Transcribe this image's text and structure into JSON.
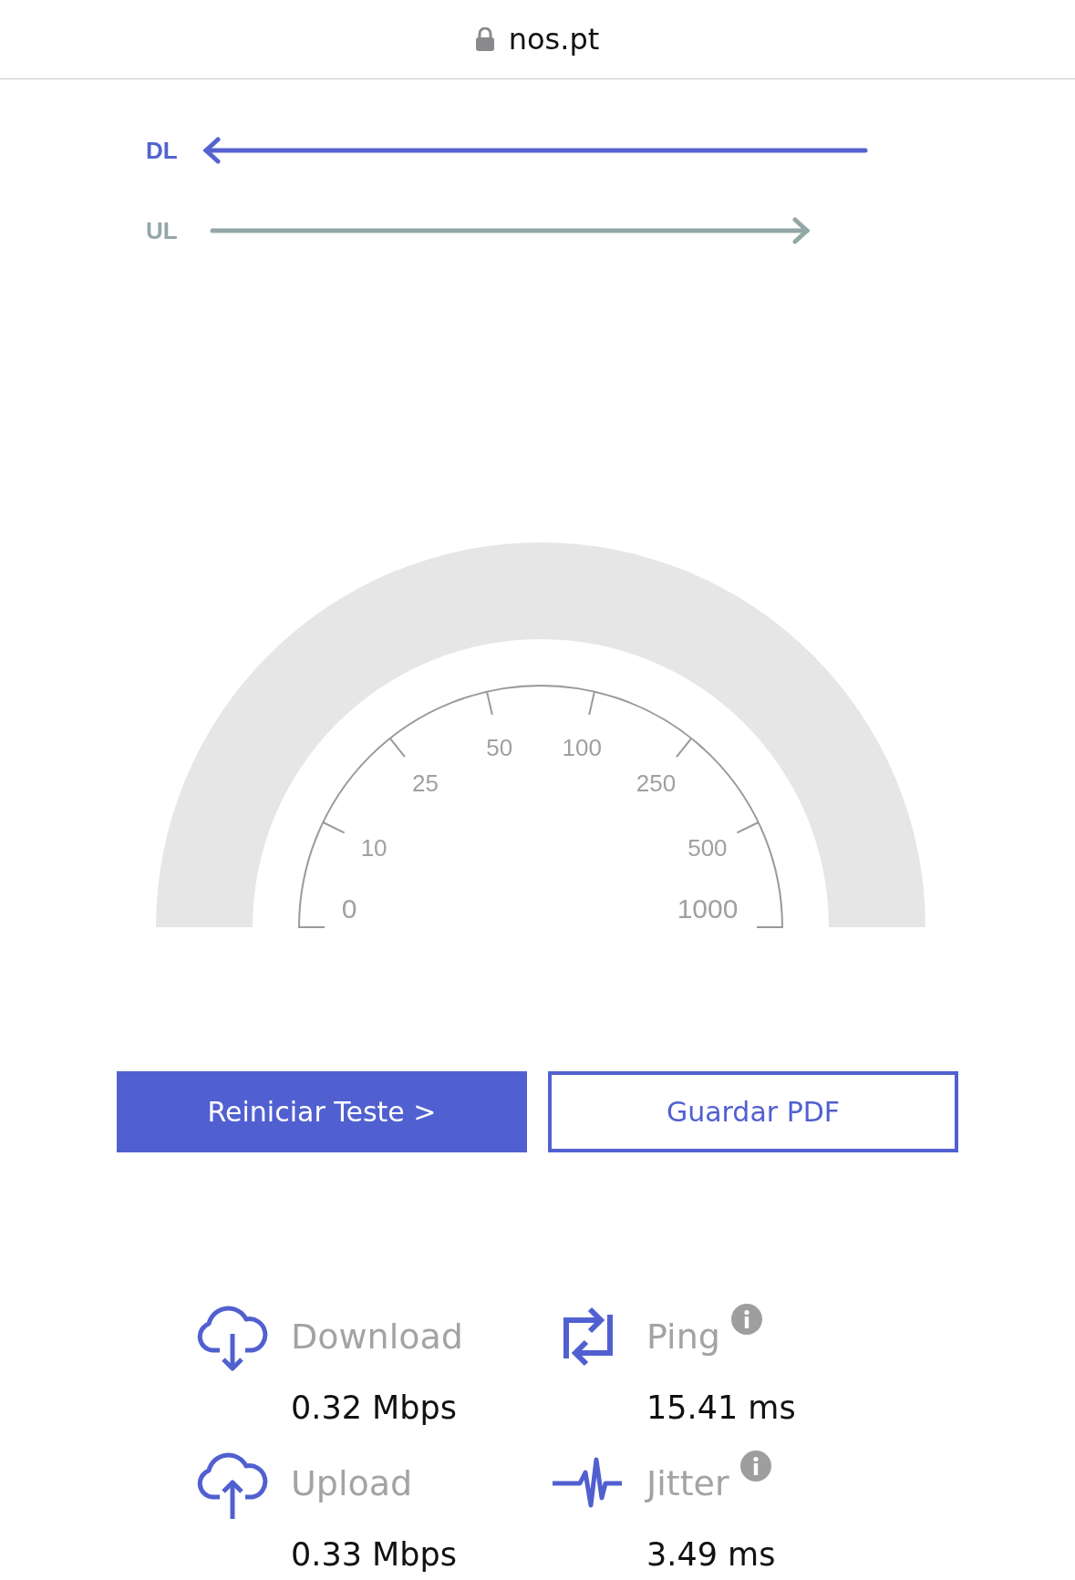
{
  "address_bar": {
    "domain": "nos.pt"
  },
  "direction_legend": [
    {
      "kind": "download",
      "label": "DL",
      "color": "#5563d0"
    },
    {
      "kind": "upload",
      "label": "UL",
      "color": "#93a8a6"
    }
  ],
  "gauge": {
    "scale_labels": [
      "0",
      "10",
      "25",
      "50",
      "100",
      "250",
      "500",
      "1000"
    ]
  },
  "buttons": [
    {
      "kind": "primary",
      "label": "Reiniciar Teste >"
    },
    {
      "kind": "outline",
      "label": "Guardar PDF"
    }
  ],
  "stats": [
    {
      "kind": "download",
      "label": "Download",
      "value": "0.32 Mbps",
      "info": false
    },
    {
      "kind": "ping",
      "label": "Ping",
      "value": "15.41 ms",
      "info": true
    },
    {
      "kind": "upload",
      "label": "Upload",
      "value": "0.33 Mbps",
      "info": false
    },
    {
      "kind": "jitter",
      "label": "Jitter",
      "value": "3.49 ms",
      "info": true
    }
  ]
}
